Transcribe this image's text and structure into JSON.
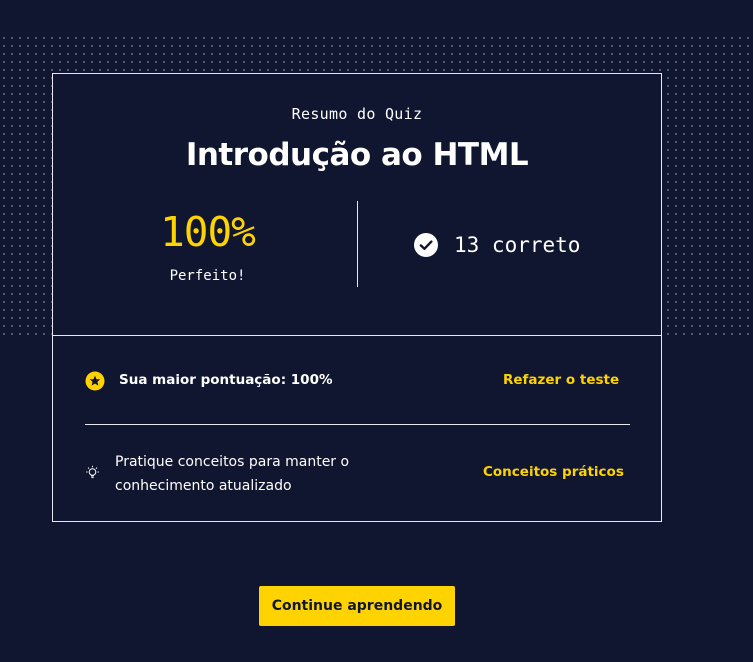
{
  "summary": {
    "eyebrow": "Resumo do Quiz",
    "title": "Introdução ao HTML",
    "score": "100%",
    "score_label": "Perfeito!",
    "correct_text": "13 correto"
  },
  "details": {
    "high_score": "Sua maior pontuação: 100%",
    "retake_label": "Refazer o teste",
    "practice_text": "Pratique conceitos para manter o conhecimento atualizado",
    "practice_link": "Conceitos práticos"
  },
  "actions": {
    "continue_label": "Continue aprendendo"
  },
  "icons": {
    "correct": "check-circle-icon",
    "high_score": "star-circle-icon",
    "practice": "lightbulb-icon"
  },
  "colors": {
    "background": "#10162f",
    "accent": "#ffd300",
    "text": "#ffffff"
  }
}
